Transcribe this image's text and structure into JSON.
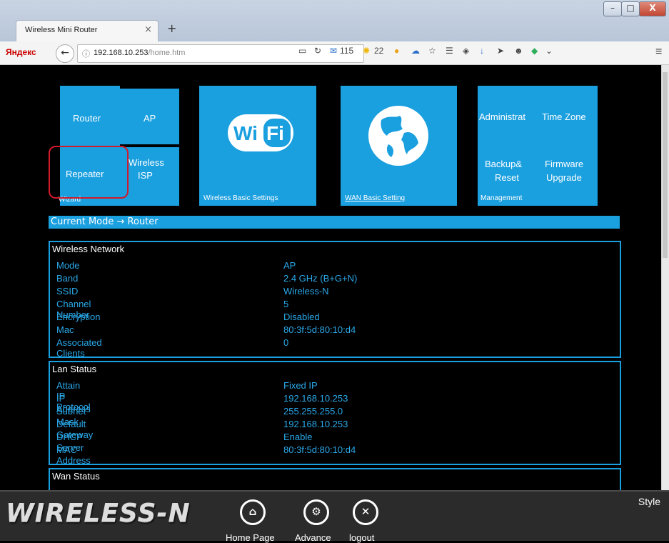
{
  "browser": {
    "tab_title": "Wireless Mini Router",
    "tab_close": "×",
    "new_tab": "+",
    "brand": "Яндекс",
    "url_host": "192.168.10.253",
    "url_path": "/home.htm",
    "mail_count": "115",
    "weather_temp": "22"
  },
  "tiles": {
    "router": "Router",
    "ap": "AP",
    "repeater": "Repeater",
    "wireless_isp_1": "Wireless",
    "wireless_isp_2": "ISP",
    "wizard": "Wizard",
    "wifi_logo": "Wi Fi",
    "wireless_basic": "Wireless Basic Settings",
    "wan_basic": "WAN Basic Setting",
    "administrat": "Administrat",
    "time_zone": "Time Zone",
    "backup_1": "Backup&",
    "backup_2": "Reset",
    "firmware_1": "Firmware",
    "firmware_2": "Upgrade",
    "management": "Management"
  },
  "mode_bar": "Current Mode → Router",
  "wireless_network": {
    "title": "Wireless Network",
    "rows": [
      {
        "k": "Mode",
        "v": "AP"
      },
      {
        "k": "Band",
        "v": "2.4 GHz (B+G+N)"
      },
      {
        "k": "SSID",
        "v": "Wireless-N"
      },
      {
        "k": "Channel Number",
        "v": "5"
      },
      {
        "k": "Encryption",
        "v": "Disabled"
      },
      {
        "k": "Mac",
        "v": "80:3f:5d:80:10:d4"
      },
      {
        "k": "Associated Clients",
        "v": "0"
      }
    ]
  },
  "lan_status": {
    "title": "Lan Status",
    "rows": [
      {
        "k": "Attain IP Protocol",
        "v": "Fixed IP"
      },
      {
        "k": "IP Address",
        "v": "192.168.10.253"
      },
      {
        "k": "Subnet Mask",
        "v": "255.255.255.0"
      },
      {
        "k": "Default Gateway",
        "v": "192.168.10.253"
      },
      {
        "k": "DHCP Server",
        "v": "Enable"
      },
      {
        "k": "MAC Address",
        "v": "80:3f:5d:80:10:d4"
      }
    ]
  },
  "wan_status": {
    "title": "Wan Status"
  },
  "bottom": {
    "logo": "WIRELESS-N",
    "home": "Home Page",
    "advance": "Advance",
    "logout": "logout",
    "style": "Style"
  },
  "colors": {
    "accent": "#1a9fdf",
    "value_text": "#2aa8e8",
    "highlight": "#d11a2a"
  }
}
